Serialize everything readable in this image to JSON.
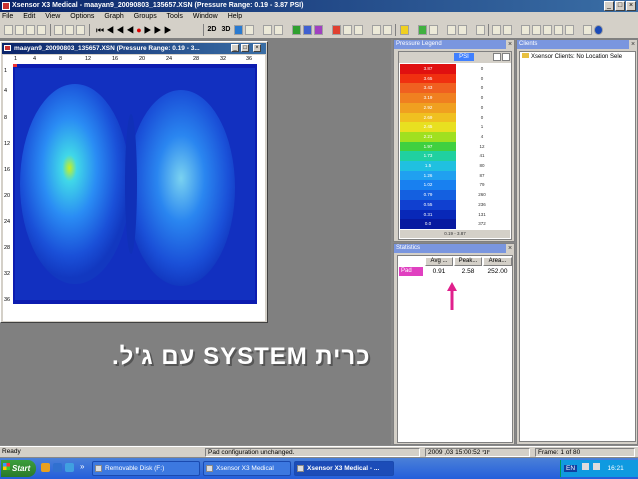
{
  "window": {
    "title": "Xsensor X3 Medical - maayan9_20090803_135657.XSN  (Pressure Range: 0.19 - 3.87 PSI)"
  },
  "menu": [
    "File",
    "Edit",
    "View",
    "Options",
    "Graph",
    "Groups",
    "Tools",
    "Window",
    "Help"
  ],
  "toolbar": {
    "btn_2d": "2D",
    "btn_3d": "3D"
  },
  "map_window": {
    "title": "maayan9_20090803_135657.XSN  (Pressure Range: 0.19 - 3...",
    "col_ticks": [
      "1",
      "4",
      "8",
      "12",
      "16",
      "20",
      "24",
      "28",
      "32",
      "36"
    ],
    "row_ticks": [
      "1",
      "4",
      "8",
      "12",
      "16",
      "20",
      "24",
      "28",
      "32",
      "36"
    ],
    "colors": {
      "low": "#0a1ab8",
      "mid": "#2a6cf0",
      "high": "#7ad2f0",
      "peak": "#c8f020"
    }
  },
  "caption": "כרית SYSTEM עם ג'ל.",
  "legend": {
    "title": "Pressure Legend",
    "unit": "PSI",
    "levels": [
      "3.87",
      "3.65",
      "3.43",
      "3.19",
      "2.92",
      "2.69",
      "2.45",
      "2.21",
      "1.97",
      "1.73",
      "1.5",
      "1.26",
      "1.02",
      "0.79",
      "0.55",
      "0.31",
      "0.0"
    ],
    "counts": [
      "0",
      "0",
      "0",
      "0",
      "0",
      "0",
      "1",
      "4",
      "12",
      "41",
      "80",
      "87",
      "79",
      "260",
      "236",
      "131",
      "372"
    ],
    "range": "0.19 - 3.87"
  },
  "statistics": {
    "title": "Statistics",
    "headers": [
      "Avg ...",
      "Peak...",
      "Area..."
    ],
    "row": {
      "label": "Pad",
      "avg": "0.91",
      "peak": "2.58",
      "area": "252.00"
    }
  },
  "clients": {
    "title": "Clients",
    "item": "Xsensor Clients: No Location Sele"
  },
  "statusbar": {
    "ready": "Ready",
    "message": "Pad configuration unchanged.",
    "datetime": "2009 ,03 יוני 15:00:52",
    "frame": "Frame: 1 of 80"
  },
  "taskbar": {
    "start": "Start",
    "tasks": [
      "Removable Disk (F:)",
      "Xsensor X3 Medical",
      "Xsensor X3 Medical - ..."
    ],
    "lang": "EN",
    "clock": "16:21"
  }
}
